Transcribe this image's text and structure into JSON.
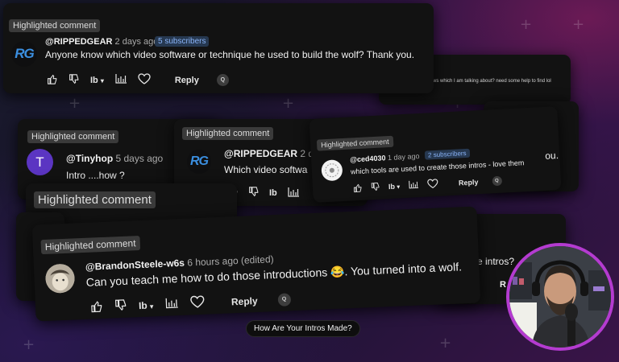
{
  "bottom_caption": "How Are Your Intros Made?",
  "cards": {
    "top": {
      "badge": "Highlighted comment",
      "handle": "@RIPPEDGEAR",
      "time": "2 days ago",
      "subscribers": "5 subscribers",
      "text": "Anyone know which video software or technique he used to build the wolf? Thank you.",
      "reply": "Reply",
      "avatar_text": "RG"
    },
    "back_right": {
      "text": "...ws which I am talking about? need some help to find lol"
    },
    "tinyhop": {
      "badge": "Highlighted comment",
      "handle": "@Tinyhop",
      "time": "5 days ago",
      "text": "Intro ....how ?",
      "avatar_letter": "T"
    },
    "rippedgear2": {
      "badge": "Highlighted comment",
      "handle": "@RIPPEDGEAR",
      "time": "2 d",
      "text": "Which video softwa"
    },
    "ced": {
      "badge": "Highlighted comment",
      "handle": "@ced4030",
      "time": "1 day ago",
      "subscribers": "2 subscribers",
      "text": "which tools are used to create those intros - love them",
      "reply": "Reply",
      "overflow_text": "ou."
    },
    "middle_badge": "Highlighted comment",
    "brandon": {
      "badge": "Highlighted comment",
      "handle": "@BrandonSteele-w6s",
      "time": "6 hours ago (edited)",
      "text_before": "Can you teach me how to do those introductions",
      "emoji": "😂",
      "text_after": ". You turned into a wolf.",
      "reply": "Reply"
    },
    "right_partial": {
      "text": "e intros?",
      "reply": "R"
    }
  },
  "action_labels": {
    "dislike_count": "Ib",
    "caret": "▾",
    "q": "Q"
  },
  "colors": {
    "accent_ring": "#b43bd0",
    "subs_bg": "#263850",
    "subs_text": "#8ab4f8",
    "card": "#121212",
    "badge": "#3a3a3a"
  }
}
